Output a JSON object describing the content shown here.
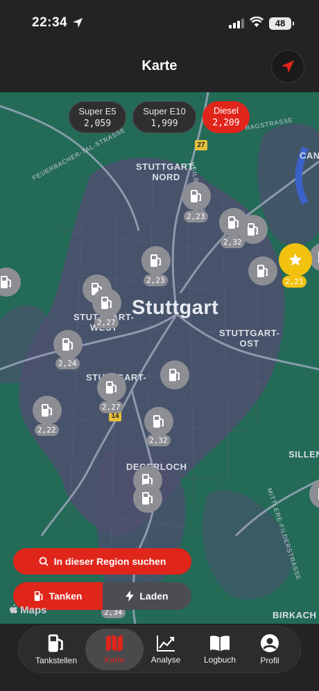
{
  "status": {
    "time": "22:34",
    "battery": "48"
  },
  "header": {
    "title": "Karte"
  },
  "fuel_types": [
    {
      "name": "Super E5",
      "price": "2,059",
      "selected": false
    },
    {
      "name": "Super E10",
      "price": "1,999",
      "selected": false
    },
    {
      "name": "Diesel",
      "price": "2,209",
      "selected": true
    }
  ],
  "map": {
    "city": "Stuttgart",
    "districts": {
      "nord": "STUTTGART-\nNORD",
      "west": "STUTTGART-\nWEST",
      "ost": "STUTTGART-\nOST",
      "sued": "STUTTGART-",
      "degerloch": "DEGERLOCH",
      "sillen": "SILLEN",
      "birkach": "BIRKACH",
      "can": "CAN"
    },
    "streets": {
      "feuerbacher": "FEUERBACHER-TAL-STRASSE",
      "heilbronner": "HEILBRONNER",
      "ragstrasse": "RAGSTRASSE",
      "mittlere": "MITTLERE-FILDERSTRASSE"
    },
    "shields": {
      "a": "27",
      "b": "14"
    },
    "stations": [
      {
        "price": "2,23"
      },
      {
        "price": "2,32"
      },
      {
        "price": "2,21"
      },
      {
        "price": "2,23"
      },
      {
        "price": "2,27"
      },
      {
        "price": "2,24"
      },
      {
        "price": "2,27"
      },
      {
        "price": "2,22"
      },
      {
        "price": "2,32"
      },
      {
        "price": "2,34"
      }
    ],
    "maps_attribution": "Maps"
  },
  "actions": {
    "search_region": "In dieser Region suchen",
    "tanken": "Tanken",
    "laden": "Laden"
  },
  "tabs": [
    {
      "label": "Tankstellen"
    },
    {
      "label": "Karte"
    },
    {
      "label": "Analyse"
    },
    {
      "label": "Logbuch"
    },
    {
      "label": "Profil"
    }
  ],
  "colors": {
    "accent": "#e0251b",
    "favorite": "#f2c20f",
    "map_green": "#236a57",
    "map_urban": "#4d4f6e"
  }
}
